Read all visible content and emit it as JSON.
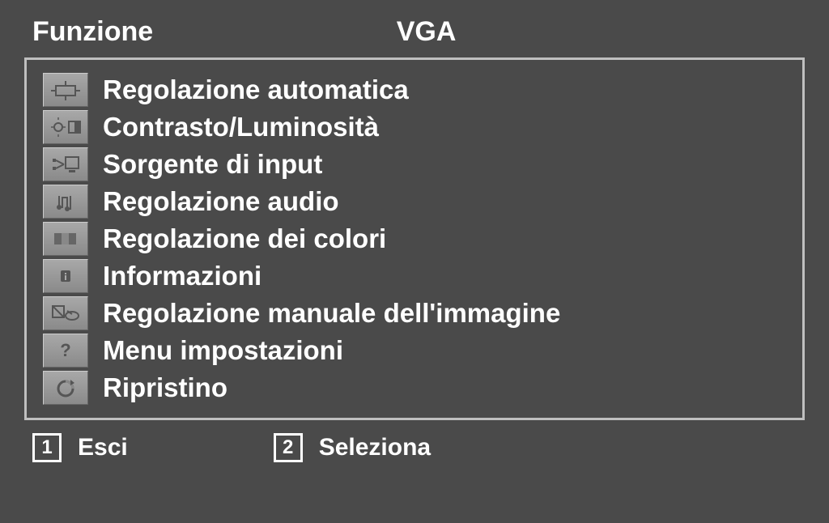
{
  "header": {
    "title": "Funzione",
    "mode": "VGA"
  },
  "menu": {
    "items": [
      {
        "icon": "auto-adjust-icon",
        "label": "Regolazione automatica"
      },
      {
        "icon": "contrast-brightness-icon",
        "label": "Contrasto/Luminosità"
      },
      {
        "icon": "input-source-icon",
        "label": "Sorgente di input"
      },
      {
        "icon": "audio-adjust-icon",
        "label": "Regolazione audio"
      },
      {
        "icon": "color-adjust-icon",
        "label": "Regolazione dei colori"
      },
      {
        "icon": "information-icon",
        "label": "Informazioni"
      },
      {
        "icon": "manual-image-adjust-icon",
        "label": "Regolazione manuale dell'immagine"
      },
      {
        "icon": "setup-menu-icon",
        "label": "Menu impostazioni"
      },
      {
        "icon": "memory-recall-icon",
        "label": "Ripristino"
      }
    ]
  },
  "footer": {
    "key1": {
      "key": "1",
      "label": "Esci"
    },
    "key2": {
      "key": "2",
      "label": "Seleziona"
    }
  }
}
